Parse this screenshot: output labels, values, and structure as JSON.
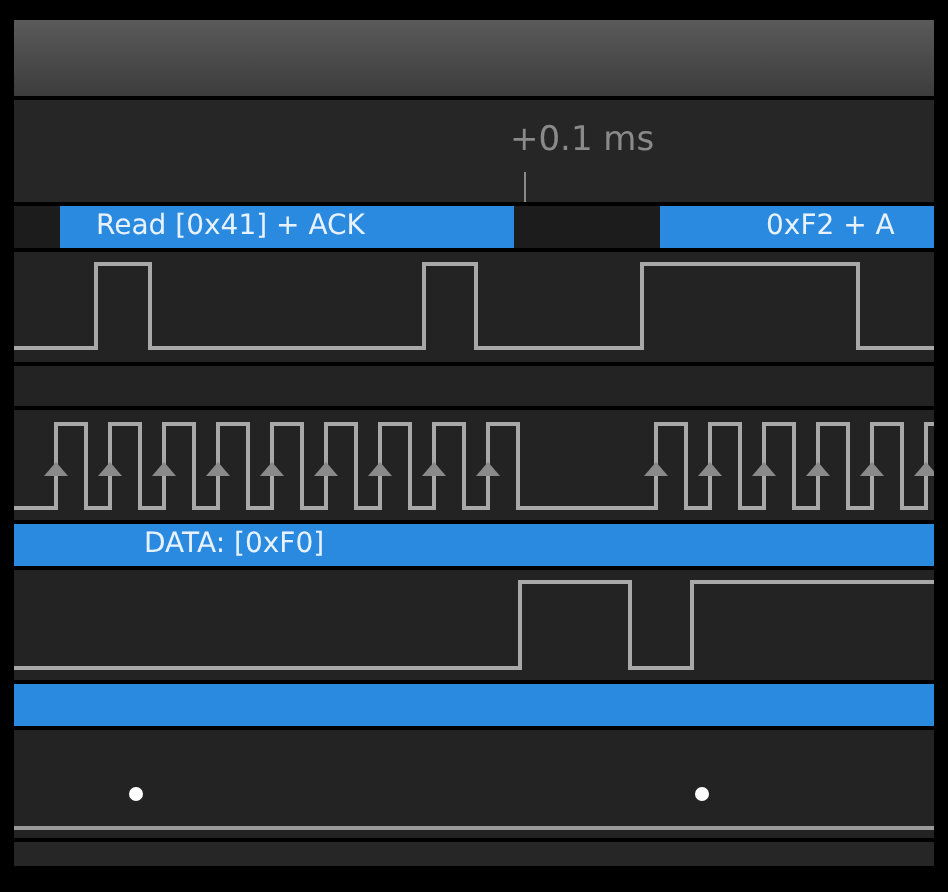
{
  "ruler": {
    "label": "+0.1 ms"
  },
  "rows": [
    {
      "kind": "annotations",
      "items": [
        {
          "text": "Read [0x41] + ACK"
        },
        {
          "text": "0xF2 + A"
        }
      ]
    },
    {
      "kind": "waveform"
    },
    {
      "kind": "empty"
    },
    {
      "kind": "clock"
    },
    {
      "kind": "decode",
      "text": "DATA: [0xF0]"
    },
    {
      "kind": "waveform"
    },
    {
      "kind": "decode"
    },
    {
      "kind": "dots"
    }
  ]
}
